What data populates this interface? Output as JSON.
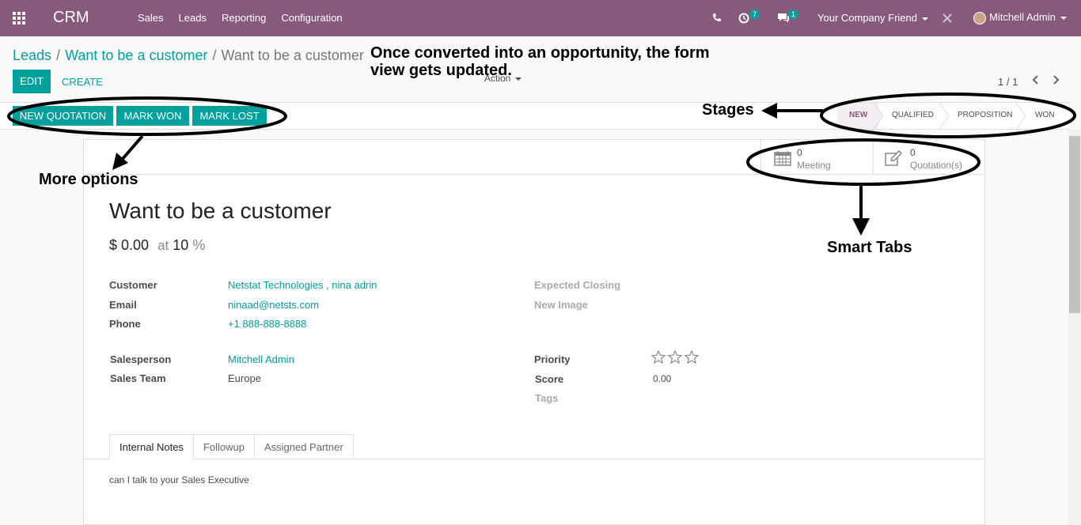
{
  "navbar": {
    "brand": "CRM",
    "menu": [
      "Sales",
      "Leads",
      "Reporting",
      "Configuration"
    ],
    "activity_count": "7",
    "message_count": "1",
    "company": "Your Company Friend",
    "user": "Mitchell Admin"
  },
  "breadcrumb": {
    "root": "Leads",
    "parent": "Want to be a customer",
    "current": "Want to be a customer"
  },
  "controls": {
    "edit": "EDIT",
    "create": "CREATE",
    "action": "Action",
    "pager": "1 / 1"
  },
  "statusbar": {
    "buttons": [
      "NEW QUOTATION",
      "MARK WON",
      "MARK LOST"
    ],
    "stages": [
      "NEW",
      "QUALIFIED",
      "PROPOSITION",
      "WON"
    ],
    "active_stage": "NEW"
  },
  "smart_buttons": [
    {
      "count": "0",
      "label": "Meeting",
      "icon": "calendar-icon"
    },
    {
      "count": "0",
      "label": "Quotation(s)",
      "icon": "edit-icon"
    }
  ],
  "record": {
    "title": "Want to be a customer",
    "revenue": "$ 0.00",
    "at": "at",
    "probability": "10",
    "percent": "%"
  },
  "fields": {
    "customer_label": "Customer",
    "customer": "Netstat Technologies , nina adrin",
    "email_label": "Email",
    "email": "ninaad@netsts.com",
    "phone_label": "Phone",
    "phone": "+1 888-888-8888",
    "salesperson_label": "Salesperson",
    "salesperson": "Mitchell Admin",
    "team_label": "Sales Team",
    "team": "Europe",
    "closing_label": "Expected Closing",
    "image_label": "New Image",
    "priority_label": "Priority",
    "priority_stars": 0,
    "score_label": "Score",
    "score": "0.00",
    "tags_label": "Tags"
  },
  "notebook": {
    "tabs": [
      "Internal Notes",
      "Followup",
      "Assigned Partner"
    ],
    "active": "Internal Notes",
    "note": "can I talk to your Sales Executive"
  },
  "annotations": {
    "header_line1": "Once converted into an opportunity, the form",
    "header_line2": "view gets updated.",
    "stages": "Stages",
    "more_options": "More options",
    "smart_tabs": "Smart Tabs"
  }
}
